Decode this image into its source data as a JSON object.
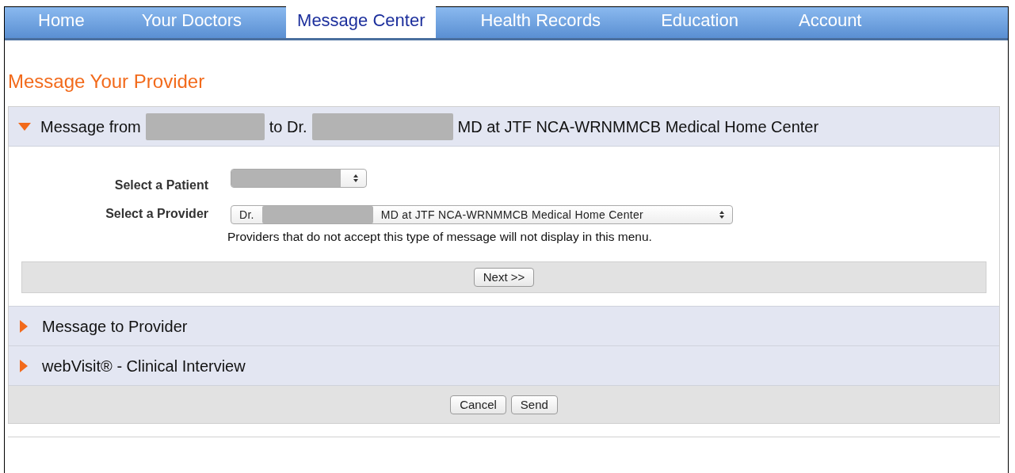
{
  "nav_tabs": [
    {
      "label": "Home",
      "selected": false
    },
    {
      "label": "Your Doctors",
      "selected": false
    },
    {
      "label": "Message Center",
      "selected": true
    },
    {
      "label": "Health Records",
      "selected": false
    },
    {
      "label": "Education",
      "selected": false
    },
    {
      "label": "Account",
      "selected": false
    }
  ],
  "page_title": "Message Your Provider",
  "sections": [
    {
      "header_parts": [
        "Message from",
        "to Dr.",
        "MD at JTF NCA-WRNMMCB Medical Home Center"
      ],
      "expanded": true,
      "form": {
        "fields": [
          {
            "label": "Select a Patient"
          },
          {
            "label": "Select a Provider",
            "value_parts": [
              "Dr.",
              "MD at JTF NCA-WRNMMCB Medical Home Center"
            ],
            "help": "Providers that do not accept this type of message will not display in this menu."
          }
        ],
        "button": "Next >>"
      }
    },
    {
      "header_parts": [
        "Message to Provider"
      ],
      "expanded": false
    },
    {
      "header_parts": [
        "webVisit® - Clinical Interview"
      ],
      "expanded": false
    }
  ],
  "footer_buttons": [
    "Cancel",
    "Send"
  ]
}
